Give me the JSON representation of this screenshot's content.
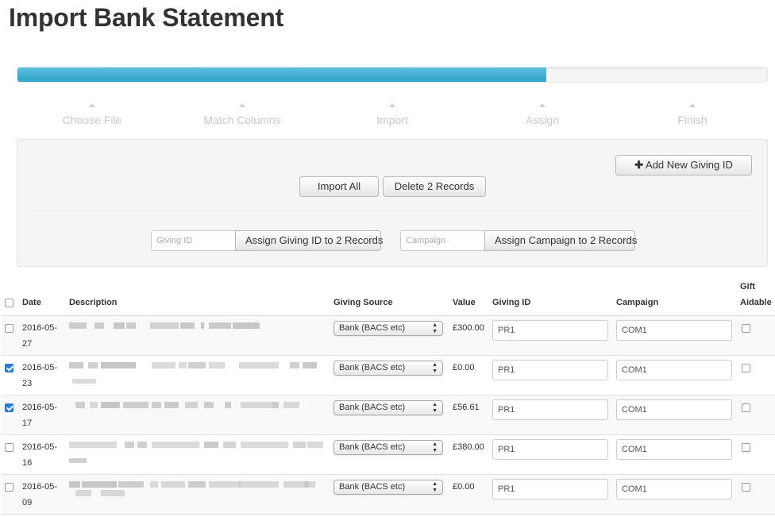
{
  "page": {
    "title": "Import Bank Statement"
  },
  "progress": {
    "percent": 70.5
  },
  "steps": [
    {
      "label": "Choose File"
    },
    {
      "label": "Match Columns"
    },
    {
      "label": "Import"
    },
    {
      "label": "Assign"
    },
    {
      "label": "Finish"
    }
  ],
  "actions": {
    "add_giving_id": "Add New Giving ID",
    "import_all": "Import All",
    "delete_records": "Delete 2 Records",
    "giving_id_placeholder": "Giving ID",
    "assign_giving_id": "Assign Giving ID to 2 Records",
    "campaign_placeholder": "Campaign",
    "assign_campaign": "Assign Campaign to 2 Records"
  },
  "table": {
    "headers": {
      "date": "Date",
      "description": "Description",
      "giving_source": "Giving Source",
      "value": "Value",
      "giving_id": "Giving ID",
      "campaign": "Campaign",
      "gift_aidable_line1": "Gift",
      "gift_aidable_line2": "Aidable"
    },
    "rows": [
      {
        "checked": false,
        "date": "2016-05-27",
        "source": "Bank (BACS etc)",
        "value": "£300.00",
        "giving_id": "PR1",
        "campaign": "COM1",
        "gift_aidable": false
      },
      {
        "checked": true,
        "date": "2016-05-23",
        "source": "Bank (BACS etc)",
        "value": "£0.00",
        "giving_id": "PR1",
        "campaign": "COM1",
        "gift_aidable": false
      },
      {
        "checked": true,
        "date": "2016-05-17",
        "source": "Bank (BACS etc)",
        "value": "£56.61",
        "giving_id": "PR1",
        "campaign": "COM1",
        "gift_aidable": false
      },
      {
        "checked": false,
        "date": "2016-05-16",
        "source": "Bank (BACS etc)",
        "value": "£380.00",
        "giving_id": "PR1",
        "campaign": "COM1",
        "gift_aidable": false
      },
      {
        "checked": false,
        "date": "2016-05-09",
        "source": "Bank (BACS etc)",
        "value": "£0.00",
        "giving_id": "PR1",
        "campaign": "COM1",
        "gift_aidable": false
      }
    ]
  },
  "colors": {
    "progress": "#2fa4c7",
    "checkbox_checked": "#2a79d8"
  }
}
